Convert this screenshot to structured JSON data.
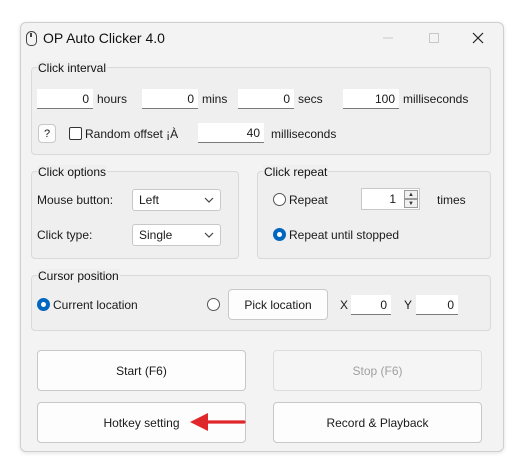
{
  "window": {
    "title": "OP Auto Clicker 4.0"
  },
  "click_interval": {
    "label": "Click interval",
    "hours": {
      "value": "0",
      "unit": "hours"
    },
    "mins": {
      "value": "0",
      "unit": "mins"
    },
    "secs": {
      "value": "0",
      "unit": "secs"
    },
    "milliseconds": {
      "value": "100",
      "unit": "milliseconds"
    },
    "help_label": "?",
    "random_offset_label": "Random offset ¡À",
    "random_offset_value": "40",
    "random_offset_unit": "milliseconds"
  },
  "click_options": {
    "label": "Click options",
    "mouse_button_label": "Mouse button:",
    "mouse_button_value": "Left",
    "click_type_label": "Click type:",
    "click_type_value": "Single"
  },
  "click_repeat": {
    "label": "Click repeat",
    "repeat_label": "Repeat",
    "repeat_value": "1",
    "times_label": "times",
    "until_stopped_label": "Repeat until stopped"
  },
  "cursor_position": {
    "label": "Cursor position",
    "current_location_label": "Current location",
    "pick_location_label": "Pick location",
    "x_label": "X",
    "x_value": "0",
    "y_label": "Y",
    "y_value": "0"
  },
  "buttons": {
    "start": "Start (F6)",
    "stop": "Stop (F6)",
    "hotkey": "Hotkey setting",
    "record": "Record & Playback"
  },
  "colors": {
    "accent": "#0067c0",
    "arrow": "#e0282c"
  }
}
